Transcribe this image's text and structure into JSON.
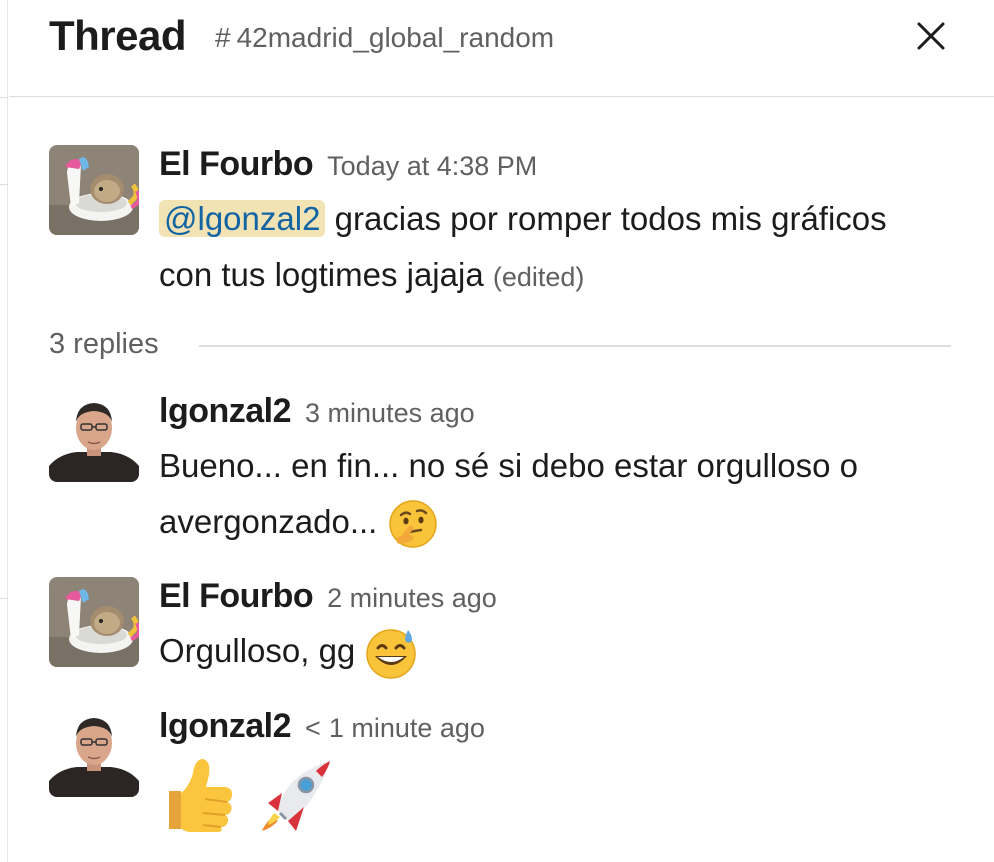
{
  "header": {
    "title": "Thread",
    "channel_hash": "#",
    "channel_name": "42madrid_global_random",
    "close_icon": "close-icon"
  },
  "root_message": {
    "author": "El Fourbo",
    "time": "Today at 4:38 PM",
    "mention": "@lgonzal2",
    "line1": "gracias por romper todos mis gráficos",
    "line2": "con tus logtimes jajaja",
    "edited": "(edited)",
    "avatar": "unicorn-float-avatar"
  },
  "replies_divider": {
    "label": "3 replies"
  },
  "replies": [
    {
      "author": "lgonzal2",
      "time": "3 minutes ago",
      "line1": "Bueno... en fin... no sé si debo estar orgulloso o",
      "line2": "avergonzado...",
      "emoji": "thinking-face",
      "avatar": "man-glasses-avatar"
    },
    {
      "author": "El Fourbo",
      "time": "2 minutes ago",
      "line1": "Orgulloso, gg",
      "emoji": "grinning-sweat",
      "avatar": "unicorn-float-avatar"
    },
    {
      "author": "lgonzal2",
      "time_prefix": "<",
      "time": "1 minute ago",
      "emojis": [
        "thumbs-up",
        "rocket"
      ],
      "avatar": "man-glasses-avatar"
    }
  ],
  "colors": {
    "mention_bg": "#f2e3b5",
    "mention_text": "#1264a3",
    "muted_text": "#616061",
    "divider": "#dddddd"
  }
}
